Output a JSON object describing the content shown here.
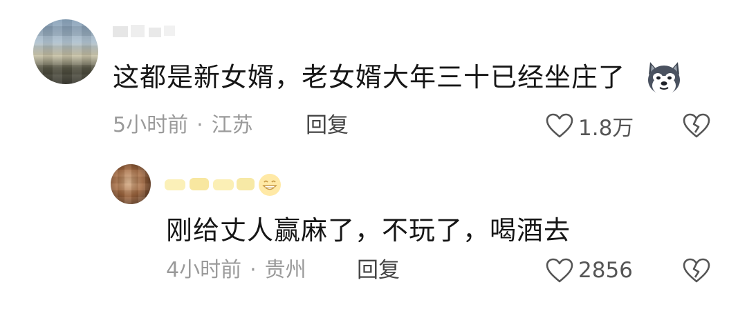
{
  "comments": [
    {
      "text": "这都是新女婿，老女婿大年三十已经坐庄了",
      "emoji_icon": "husky-dog-emoji",
      "time": "5小时前",
      "separator": "·",
      "location": "江苏",
      "reply_label": "回复",
      "likes": "1.8万"
    },
    {
      "text": "刚给丈人赢麻了，不玩了，喝酒去",
      "username_emoji_icon": "grinning-face-emoji",
      "time": "4小时前",
      "separator": "·",
      "location": "贵州",
      "reply_label": "回复",
      "likes": "2856"
    }
  ],
  "colors": {
    "text": "#161616",
    "meta": "#9a9a9a",
    "action": "#444444",
    "blur_name": "#f6e9a8"
  }
}
